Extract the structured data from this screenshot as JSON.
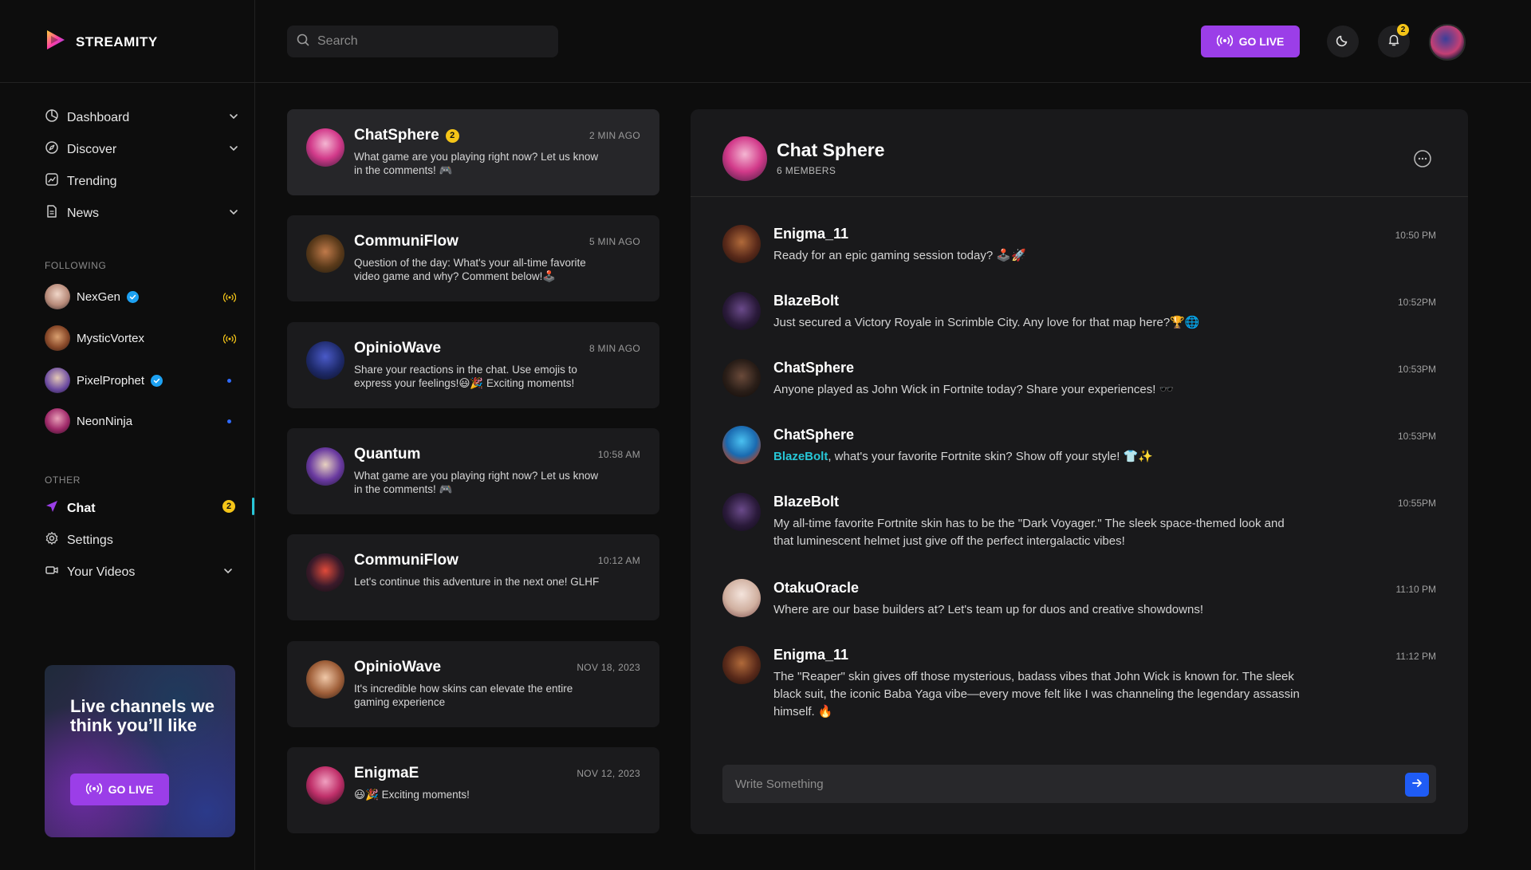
{
  "brand": {
    "name": "STREAMITY"
  },
  "search": {
    "placeholder": "Search"
  },
  "topbar": {
    "go_live_label": "GO LIVE",
    "notification_count": "2"
  },
  "sidebar": {
    "nav": [
      {
        "label": "Dashboard"
      },
      {
        "label": "Discover"
      },
      {
        "label": "Trending"
      },
      {
        "label": "News"
      }
    ],
    "following_label": "FOLLOWING",
    "following": [
      {
        "name": "NexGen"
      },
      {
        "name": "MysticVortex"
      },
      {
        "name": "PixelProphet"
      },
      {
        "name": "NeonNinja"
      }
    ],
    "other_label": "OTHER",
    "other": [
      {
        "label": "Chat",
        "badge": "2"
      },
      {
        "label": "Settings"
      },
      {
        "label": "Your Videos"
      }
    ],
    "promo": {
      "title": "Live channels we think you’ll like",
      "button": "GO LIVE"
    }
  },
  "conversations": [
    {
      "name": "ChatSphere",
      "badge": "2",
      "time": "2 MIN AGO",
      "text": "What game are you playing right now? Let us know in the comments! 🎮"
    },
    {
      "name": "CommuniFlow",
      "time": "5 MIN AGO",
      "text": "Question of the day: What's your all-time favorite video game and why? Comment below!🕹️"
    },
    {
      "name": "OpinioWave",
      "time": "8 MIN AGO",
      "text": "Share your reactions in the chat. Use emojis to express your feelings!😃🎉 Exciting moments!"
    },
    {
      "name": "Quantum",
      "time": "10:58 AM",
      "text": "What game are you playing right now? Let us know in the comments! 🎮"
    },
    {
      "name": "CommuniFlow",
      "time": "10:12 AM",
      "text": "Let's continue this adventure in the next one! GLHF"
    },
    {
      "name": "OpinioWave",
      "time": "NOV 18, 2023",
      "text": " It's incredible how skins can elevate the entire gaming experience"
    },
    {
      "name": "EnigmaE",
      "time": "NOV 12, 2023",
      "text": "😃🎉 Exciting moments!"
    }
  ],
  "chat": {
    "title": "Chat Sphere",
    "members": "6 MEMBERS",
    "messages": [
      {
        "name": "Enigma_11",
        "time": "10:50 PM",
        "text": "Ready for an epic gaming session today? 🕹️🚀"
      },
      {
        "name": "BlazeBolt",
        "time": "10:52PM",
        "text": "Just secured a Victory Royale in Scrimble City. Any love for that map here?🏆🌐"
      },
      {
        "name": "ChatSphere",
        "time": "10:53PM",
        "text": "Anyone played as John Wick in Fortnite today? Share your experiences! 🕶️"
      },
      {
        "name": "ChatSphere",
        "time": "10:53PM",
        "mention": "BlazeBolt",
        "text": ", what's your favorite Fortnite skin? Show off your style! 👕✨"
      },
      {
        "name": "BlazeBolt",
        "time": "10:55PM",
        "text": "My all-time favorite Fortnite skin has to be the \"Dark Voyager.\" The sleek space-themed look and that luminescent helmet just give off the perfect intergalactic vibes!"
      },
      {
        "name": "OtakuOracle",
        "time": "11:10 PM",
        "text": "Where are our base builders at? Let's team up for duos and creative showdowns!"
      },
      {
        "name": "Enigma_11",
        "time": "11:12 PM",
        "text": "The \"Reaper\" skin gives off those mysterious, badass vibes that John Wick is known for. The sleek black suit, the iconic Baba Yaga vibe—every move felt like I was channeling the legendary assassin himself. 🔥"
      }
    ],
    "compose_placeholder": "Write Something"
  }
}
